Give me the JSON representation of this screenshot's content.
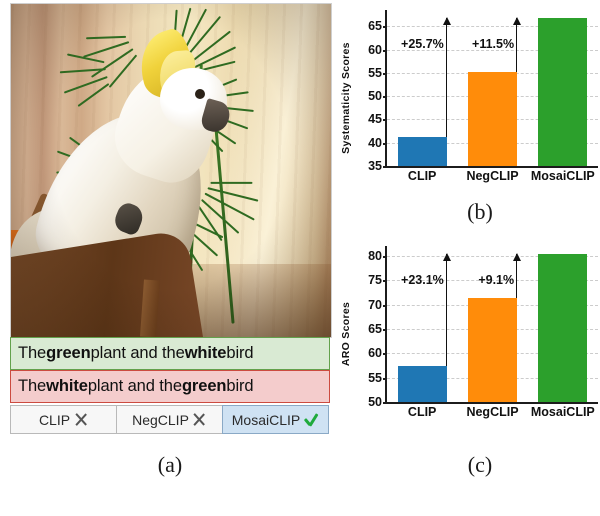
{
  "figure": {
    "subcaption_a": "(a)",
    "subcaption_b": "(b)",
    "subcaption_c": "(c)"
  },
  "example": {
    "image_alt": "white sulphur-crested cockatoo perched in front of a green palm plant",
    "positive_caption": {
      "prefix": "The ",
      "bold1": "green",
      "middle": " plant and the ",
      "bold2": "white",
      "suffix": " bird"
    },
    "negative_caption": {
      "prefix": "The ",
      "bold1": "white",
      "middle": " plant and the ",
      "bold2": "green",
      "suffix": " bird"
    },
    "models": [
      {
        "label": "CLIP",
        "mark": "cross",
        "selected": false
      },
      {
        "label": "NegCLIP",
        "mark": "cross",
        "selected": false
      },
      {
        "label": "MosaiCLIP",
        "mark": "check",
        "selected": true
      }
    ],
    "colors": {
      "positive_bg": "#d9ead3",
      "positive_border": "#63a14c",
      "negative_bg": "#f4cccc",
      "negative_border": "#cc4b40",
      "selected_bg": "#cfe2f3",
      "check": "#1faa3c",
      "cross": "#555555"
    }
  },
  "chart_data": [
    {
      "id": "b",
      "type": "bar",
      "title": "",
      "xlabel": "",
      "ylabel": "Systematicity Scores",
      "categories": [
        "CLIP",
        "NegCLIP",
        "MosaiCLIP"
      ],
      "values": [
        41.2,
        55.2,
        66.8
      ],
      "colors": [
        "#1f77b4",
        "#ff8c0a",
        "#2ca02c"
      ],
      "ylim": [
        35,
        68.5
      ],
      "yticks": [
        35,
        40,
        45,
        50,
        55,
        60,
        65
      ],
      "grid": true,
      "legend": "none",
      "annotations": [
        {
          "text": "+25.7%",
          "from_category": "CLIP",
          "from_value": 41.2,
          "to_value": 66.8
        },
        {
          "text": "+11.5%",
          "from_category": "NegCLIP",
          "from_value": 55.2,
          "to_value": 66.8
        }
      ]
    },
    {
      "id": "c",
      "type": "bar",
      "title": "",
      "xlabel": "",
      "ylabel": "ARO Scores",
      "categories": [
        "CLIP",
        "NegCLIP",
        "MosaiCLIP"
      ],
      "values": [
        57.4,
        71.4,
        80.3
      ],
      "colors": [
        "#1f77b4",
        "#ff8c0a",
        "#2ca02c"
      ],
      "ylim": [
        50,
        82
      ],
      "yticks": [
        50,
        55,
        60,
        65,
        70,
        75,
        80
      ],
      "grid": true,
      "legend": "none",
      "annotations": [
        {
          "text": "+23.1%",
          "from_category": "CLIP",
          "from_value": 57.4,
          "to_value": 80.3
        },
        {
          "text": "+9.1%",
          "from_category": "NegCLIP",
          "from_value": 71.4,
          "to_value": 80.3
        }
      ]
    }
  ]
}
